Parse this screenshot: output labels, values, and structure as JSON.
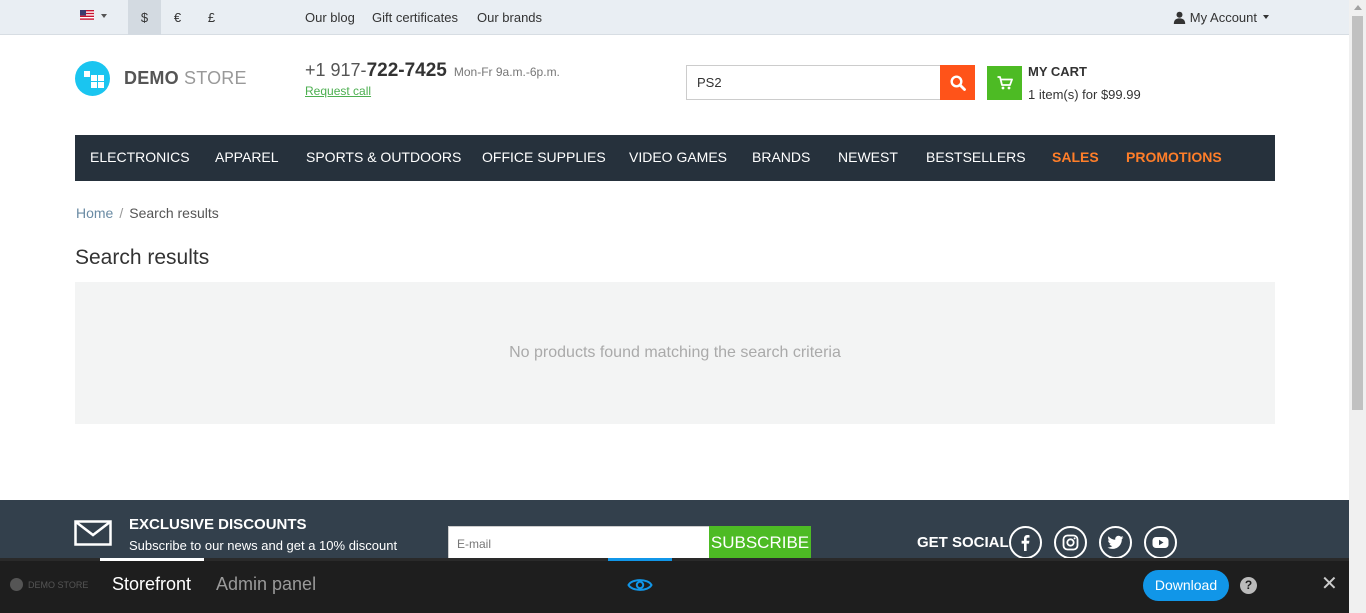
{
  "topbar": {
    "language_flag": "us-flag-icon",
    "currencies": [
      "$",
      "€",
      "£"
    ],
    "active_currency": "$",
    "links": [
      "Our blog",
      "Gift certificates",
      "Our brands"
    ],
    "account_label": "My Account"
  },
  "header": {
    "logo_bold": "DEMO",
    "logo_light": " STORE",
    "phone_prefix": "+1 917-",
    "phone_main": "722-7425",
    "phone_hours": "Mon-Fr 9a.m.-6p.m.",
    "request_call": "Request call",
    "search_value": "PS2",
    "cart_title": "MY CART",
    "cart_summary": "1 item(s) for $99.99"
  },
  "nav": {
    "items": [
      "Electronics",
      "Apparel",
      "Sports & Outdoors",
      "Office supplies",
      "Video games",
      "Brands",
      "Newest",
      "Bestsellers",
      "Sales",
      "Promotions"
    ]
  },
  "breadcrumb": {
    "home": "Home",
    "separator": "/",
    "current": "Search results"
  },
  "main": {
    "title": "Search results",
    "empty_message": "No products found matching the search criteria"
  },
  "footer": {
    "discount_title": "Exclusive discounts",
    "discount_text": "Subscribe to our news and get a 10% discount",
    "email_placeholder": "E-mail",
    "subscribe_label": "SUBSCRIBE",
    "social_title": "GET SOCIAL",
    "social_icons": [
      "facebook-icon",
      "instagram-icon",
      "twitter-icon",
      "youtube-icon"
    ]
  },
  "demo_panel": {
    "logo_text": "DEMO STORE",
    "tab_storefront": "Storefront",
    "tab_admin": "Admin panel",
    "download_label": "Download",
    "help_label": "?",
    "close_label": "✕"
  },
  "colors": {
    "accent_orange": "#ff5319",
    "accent_green": "#4dbb24",
    "nav_bg": "#26313c",
    "footer_bg": "#33404c",
    "logo_blue": "#1ac5f0",
    "download_blue": "#1196e8"
  }
}
